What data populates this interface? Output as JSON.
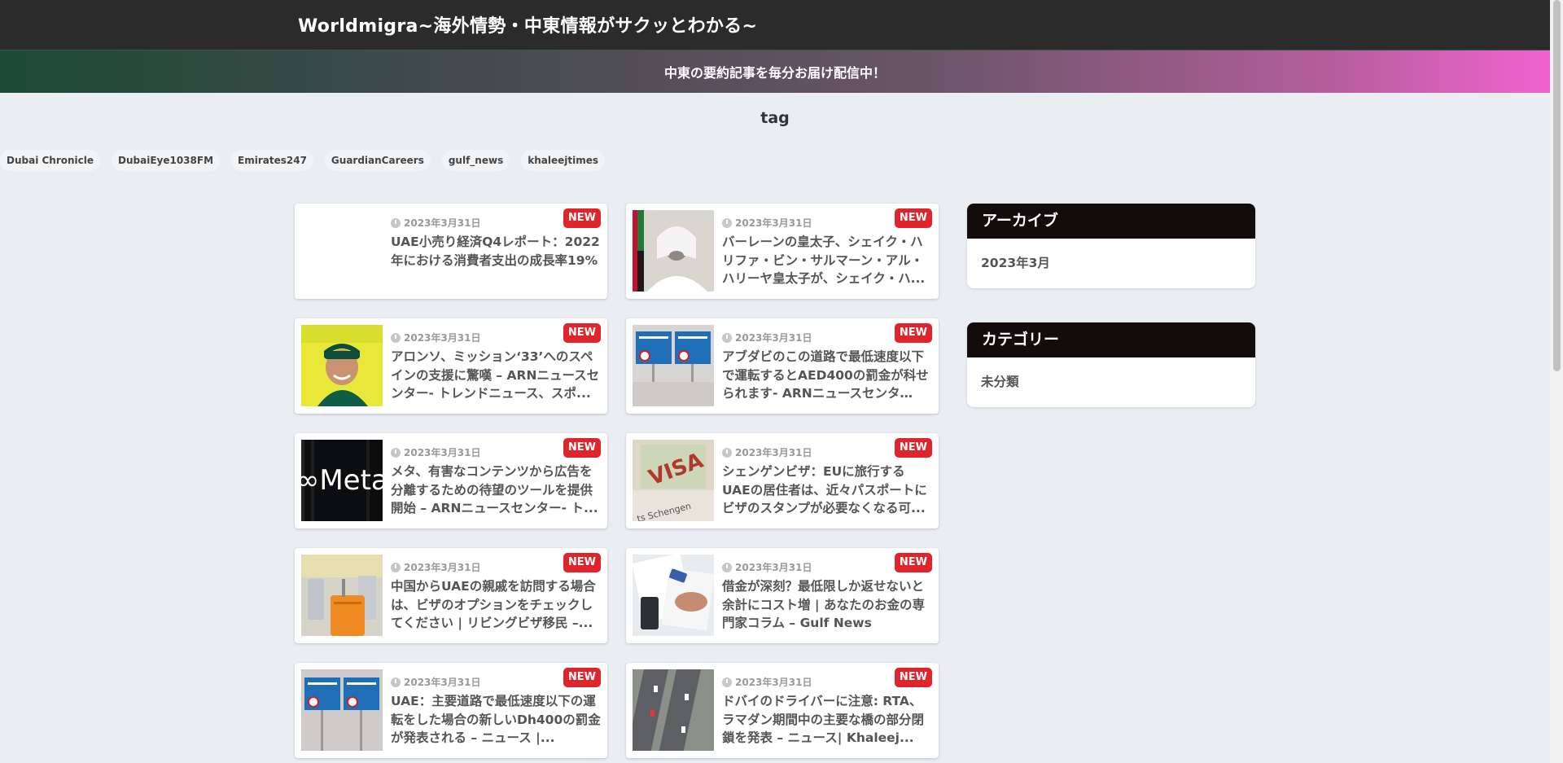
{
  "header": {
    "site_title": "Worldmigra~海外情勢・中東情報がサクッとわかる~"
  },
  "notice": {
    "text": "中東の要約記事を毎分お届け配信中！"
  },
  "section": {
    "title": "tag"
  },
  "tags": [
    "Dubai Chronicle",
    "DubaiEye1038FM",
    "Emirates247",
    "GuardianCareers",
    "gulf_news",
    "khaleejtimes"
  ],
  "badge_label": "NEW",
  "cards": [
    {
      "date": "2023年3月31日",
      "title": "UAE小売り経済Q4レポート：2022年における消費者支出の成長率19%",
      "thumb": "blank"
    },
    {
      "date": "2023年3月31日",
      "title": "バーレーンの皇太子、シェイク・ハリファ・ビン・サルマーン・アル・ハリーヤ皇太子が、シェイク・ハ...",
      "thumb": "portrait"
    },
    {
      "date": "2023年3月31日",
      "title": "アロンソ、ミッション‘33’へのスペインの支援に驚嘆 – ARNニュースセンター- トレンドニュース、スポ...",
      "thumb": "driver"
    },
    {
      "date": "2023年3月31日",
      "title": "アブダビのこの道路で最低速度以下で運転するとAED400の罰金が科せられます- ARNニュースセンター-...",
      "thumb": "road-sign"
    },
    {
      "date": "2023年3月31日",
      "title": "メタ、有害なコンテンツから広告を分離するための待望のツールを提供開始 – ARNニュースセンター- ト...",
      "thumb": "meta"
    },
    {
      "date": "2023年3月31日",
      "title": "シェンゲンビザ：EUに旅行するUAEの居住者は、近々パスポートにビザのスタンプが必要なくなる可...",
      "thumb": "visa"
    },
    {
      "date": "2023年3月31日",
      "title": "中国からUAEの親戚を訪問する場合は、ビザのオプションをチェックしてください | リビングビザ移民 –...",
      "thumb": "luggage"
    },
    {
      "date": "2023年3月31日",
      "title": "借金が深刻？最低限しか返せないと余計にコスト増 | あなたのお金の専門家コラム – Gulf News",
      "thumb": "bills"
    },
    {
      "date": "2023年3月31日",
      "title": "UAE：主要道路で最低速度以下の運転をした場合の新しいDh400の罰金が発表される – ニュース |...",
      "thumb": "road-sign"
    },
    {
      "date": "2023年3月31日",
      "title": "ドバイのドライバーに注意: RTA、ラマダン期間中の主要な橋の部分閉鎖を発表 – ニュース| Khaleej...",
      "thumb": "bridge"
    }
  ],
  "sidebar": {
    "archive": {
      "heading": "アーカイブ",
      "items": [
        "2023年3月"
      ]
    },
    "category": {
      "heading": "カテゴリー",
      "items": [
        "未分類"
      ]
    }
  }
}
